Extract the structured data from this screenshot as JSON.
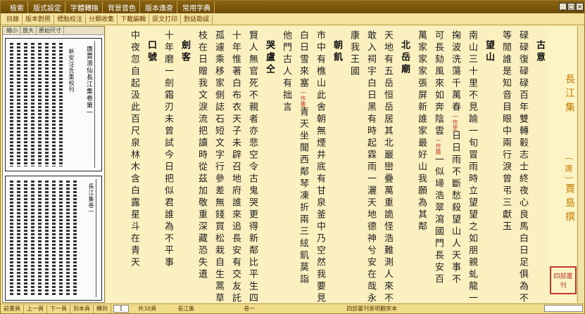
{
  "menubar": {
    "items": [
      "檢索",
      "版式設定",
      "字體轉換",
      "背景音色",
      "版本逸查",
      "常用字典"
    ]
  },
  "toolbar": {
    "items": [
      "目錄",
      "版本對照",
      "標點校注",
      "分類收集",
      "下載編輯",
      "原文打印",
      "對話勘誤"
    ]
  },
  "image_panel": {
    "tools": [
      "縮小",
      "放大",
      "原始尺寸"
    ],
    "page1_label": "唐賈浪仙長江集卷第一",
    "page1_sub": "新安汪氏重校刊",
    "page2_label": "長江集卷一"
  },
  "text_columns": [
    {
      "text": "卷一",
      "type": "title"
    },
    {
      "text": "古意",
      "type": "title"
    },
    {
      "text": "碌碌復碌碌百年雙轉轂志士終夜心良馬白日足俱為不",
      "type": "text"
    },
    {
      "text": "等閒誰是知音目眼中兩行淚曾弔三獻玉",
      "type": "text"
    },
    {
      "text": "望山",
      "type": "title"
    },
    {
      "text": "南山三十里不見踰一旬冒雨時立望望之如朋親虬龍一",
      "type": "text"
    },
    {
      "text": "掬波洗蕩千萬春",
      "type": "text",
      "note": "一作里",
      "after": "日日雨不斷愁殺望山人天事不"
    },
    {
      "text": "可長劾風來如奔陰雲",
      "type": "text",
      "note": "一作靄",
      "after": "一似埽浩翠瀉國門長安百"
    },
    {
      "text": "萬家家家張屏新誰家最好山我願為其鄰",
      "type": "text"
    },
    {
      "text": "北岳廟",
      "type": "title"
    },
    {
      "text": "天地有五岳恒岳居其北巖巒疊萬重詭怪浩難測人來不",
      "type": "text"
    },
    {
      "text": "敢入祠宇白日黑有時起霖雨一灑天地德神兮安在哉永",
      "type": "text"
    },
    {
      "text": "康我王國",
      "type": "text"
    },
    {
      "text": "朝飢",
      "type": "title"
    },
    {
      "text": "市中有樵山此舍朝無煙井底有甘泉釜中乃空然我要見",
      "type": "text"
    },
    {
      "text": "白日雪來塞",
      "type": "text",
      "note": "一作塞",
      "after": "青天坐聞西鄰琴凍折兩三絃飢莫詣"
    },
    {
      "text": "他門古人有拙言",
      "type": "text"
    },
    {
      "text": "哭盧仝",
      "type": "title"
    },
    {
      "text": "賢人無官死不親者亦悲空令古鬼哭更得新鄰比平生四",
      "type": "text"
    },
    {
      "text": "十年惟著白布衣天子未辟召地府誰來追長安有交友託",
      "type": "text"
    },
    {
      "text": "孤遽乘移家側誌石短文字行參差無錢買松栽自生蒿草",
      "type": "text"
    },
    {
      "text": "枝在日贈我文淚流把讀時從茲加敬重深藏恐失遺",
      "type": "text"
    },
    {
      "text": "劍客",
      "type": "title"
    },
    {
      "text": "十年磨一劍霜刃未曾試今日把似君誰為不平事",
      "type": "text"
    },
    {
      "text": "口號",
      "type": "title"
    },
    {
      "text": "中夜忽自起汲此百尺泉林木含白露星斗在青天",
      "type": "text"
    }
  ],
  "right_panel": {
    "book_title": "長江集",
    "author_dynasty": "〔唐〕",
    "author": "賈島撰",
    "seal_text": "四部叢刊"
  },
  "status": {
    "buttons": [
      "前書頁",
      "上一頁",
      "下一頁",
      "到本頁",
      "轉到"
    ],
    "page_input": "1",
    "total": "共38頁",
    "book": "長江集",
    "volume": "卷一",
    "edition": "四部叢刊景明翻宋本"
  }
}
